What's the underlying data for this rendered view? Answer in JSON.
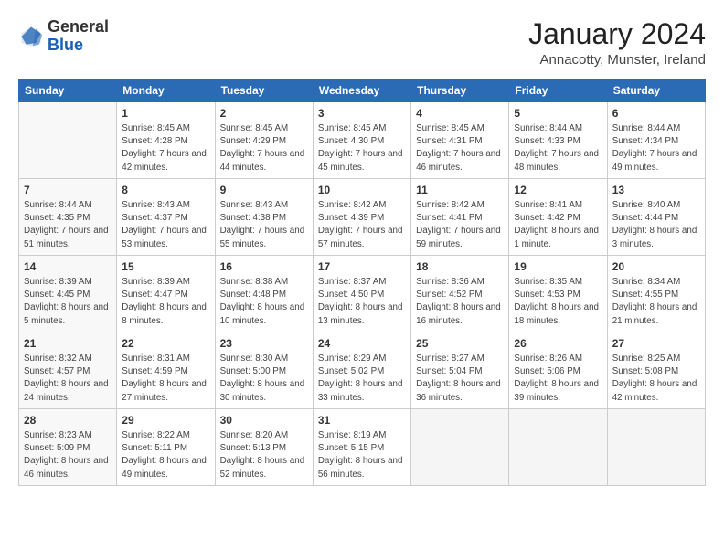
{
  "header": {
    "logo_line1": "General",
    "logo_line2": "Blue",
    "title": "January 2024",
    "subtitle": "Annacotty, Munster, Ireland"
  },
  "calendar": {
    "days_of_week": [
      "Sunday",
      "Monday",
      "Tuesday",
      "Wednesday",
      "Thursday",
      "Friday",
      "Saturday"
    ],
    "weeks": [
      [
        {
          "day": "",
          "sunrise": "",
          "sunset": "",
          "daylight": ""
        },
        {
          "day": "1",
          "sunrise": "Sunrise: 8:45 AM",
          "sunset": "Sunset: 4:28 PM",
          "daylight": "Daylight: 7 hours and 42 minutes."
        },
        {
          "day": "2",
          "sunrise": "Sunrise: 8:45 AM",
          "sunset": "Sunset: 4:29 PM",
          "daylight": "Daylight: 7 hours and 44 minutes."
        },
        {
          "day": "3",
          "sunrise": "Sunrise: 8:45 AM",
          "sunset": "Sunset: 4:30 PM",
          "daylight": "Daylight: 7 hours and 45 minutes."
        },
        {
          "day": "4",
          "sunrise": "Sunrise: 8:45 AM",
          "sunset": "Sunset: 4:31 PM",
          "daylight": "Daylight: 7 hours and 46 minutes."
        },
        {
          "day": "5",
          "sunrise": "Sunrise: 8:44 AM",
          "sunset": "Sunset: 4:33 PM",
          "daylight": "Daylight: 7 hours and 48 minutes."
        },
        {
          "day": "6",
          "sunrise": "Sunrise: 8:44 AM",
          "sunset": "Sunset: 4:34 PM",
          "daylight": "Daylight: 7 hours and 49 minutes."
        }
      ],
      [
        {
          "day": "7",
          "sunrise": "Sunrise: 8:44 AM",
          "sunset": "Sunset: 4:35 PM",
          "daylight": "Daylight: 7 hours and 51 minutes."
        },
        {
          "day": "8",
          "sunrise": "Sunrise: 8:43 AM",
          "sunset": "Sunset: 4:37 PM",
          "daylight": "Daylight: 7 hours and 53 minutes."
        },
        {
          "day": "9",
          "sunrise": "Sunrise: 8:43 AM",
          "sunset": "Sunset: 4:38 PM",
          "daylight": "Daylight: 7 hours and 55 minutes."
        },
        {
          "day": "10",
          "sunrise": "Sunrise: 8:42 AM",
          "sunset": "Sunset: 4:39 PM",
          "daylight": "Daylight: 7 hours and 57 minutes."
        },
        {
          "day": "11",
          "sunrise": "Sunrise: 8:42 AM",
          "sunset": "Sunset: 4:41 PM",
          "daylight": "Daylight: 7 hours and 59 minutes."
        },
        {
          "day": "12",
          "sunrise": "Sunrise: 8:41 AM",
          "sunset": "Sunset: 4:42 PM",
          "daylight": "Daylight: 8 hours and 1 minute."
        },
        {
          "day": "13",
          "sunrise": "Sunrise: 8:40 AM",
          "sunset": "Sunset: 4:44 PM",
          "daylight": "Daylight: 8 hours and 3 minutes."
        }
      ],
      [
        {
          "day": "14",
          "sunrise": "Sunrise: 8:39 AM",
          "sunset": "Sunset: 4:45 PM",
          "daylight": "Daylight: 8 hours and 5 minutes."
        },
        {
          "day": "15",
          "sunrise": "Sunrise: 8:39 AM",
          "sunset": "Sunset: 4:47 PM",
          "daylight": "Daylight: 8 hours and 8 minutes."
        },
        {
          "day": "16",
          "sunrise": "Sunrise: 8:38 AM",
          "sunset": "Sunset: 4:48 PM",
          "daylight": "Daylight: 8 hours and 10 minutes."
        },
        {
          "day": "17",
          "sunrise": "Sunrise: 8:37 AM",
          "sunset": "Sunset: 4:50 PM",
          "daylight": "Daylight: 8 hours and 13 minutes."
        },
        {
          "day": "18",
          "sunrise": "Sunrise: 8:36 AM",
          "sunset": "Sunset: 4:52 PM",
          "daylight": "Daylight: 8 hours and 16 minutes."
        },
        {
          "day": "19",
          "sunrise": "Sunrise: 8:35 AM",
          "sunset": "Sunset: 4:53 PM",
          "daylight": "Daylight: 8 hours and 18 minutes."
        },
        {
          "day": "20",
          "sunrise": "Sunrise: 8:34 AM",
          "sunset": "Sunset: 4:55 PM",
          "daylight": "Daylight: 8 hours and 21 minutes."
        }
      ],
      [
        {
          "day": "21",
          "sunrise": "Sunrise: 8:32 AM",
          "sunset": "Sunset: 4:57 PM",
          "daylight": "Daylight: 8 hours and 24 minutes."
        },
        {
          "day": "22",
          "sunrise": "Sunrise: 8:31 AM",
          "sunset": "Sunset: 4:59 PM",
          "daylight": "Daylight: 8 hours and 27 minutes."
        },
        {
          "day": "23",
          "sunrise": "Sunrise: 8:30 AM",
          "sunset": "Sunset: 5:00 PM",
          "daylight": "Daylight: 8 hours and 30 minutes."
        },
        {
          "day": "24",
          "sunrise": "Sunrise: 8:29 AM",
          "sunset": "Sunset: 5:02 PM",
          "daylight": "Daylight: 8 hours and 33 minutes."
        },
        {
          "day": "25",
          "sunrise": "Sunrise: 8:27 AM",
          "sunset": "Sunset: 5:04 PM",
          "daylight": "Daylight: 8 hours and 36 minutes."
        },
        {
          "day": "26",
          "sunrise": "Sunrise: 8:26 AM",
          "sunset": "Sunset: 5:06 PM",
          "daylight": "Daylight: 8 hours and 39 minutes."
        },
        {
          "day": "27",
          "sunrise": "Sunrise: 8:25 AM",
          "sunset": "Sunset: 5:08 PM",
          "daylight": "Daylight: 8 hours and 42 minutes."
        }
      ],
      [
        {
          "day": "28",
          "sunrise": "Sunrise: 8:23 AM",
          "sunset": "Sunset: 5:09 PM",
          "daylight": "Daylight: 8 hours and 46 minutes."
        },
        {
          "day": "29",
          "sunrise": "Sunrise: 8:22 AM",
          "sunset": "Sunset: 5:11 PM",
          "daylight": "Daylight: 8 hours and 49 minutes."
        },
        {
          "day": "30",
          "sunrise": "Sunrise: 8:20 AM",
          "sunset": "Sunset: 5:13 PM",
          "daylight": "Daylight: 8 hours and 52 minutes."
        },
        {
          "day": "31",
          "sunrise": "Sunrise: 8:19 AM",
          "sunset": "Sunset: 5:15 PM",
          "daylight": "Daylight: 8 hours and 56 minutes."
        },
        {
          "day": "",
          "sunrise": "",
          "sunset": "",
          "daylight": ""
        },
        {
          "day": "",
          "sunrise": "",
          "sunset": "",
          "daylight": ""
        },
        {
          "day": "",
          "sunrise": "",
          "sunset": "",
          "daylight": ""
        }
      ]
    ]
  }
}
